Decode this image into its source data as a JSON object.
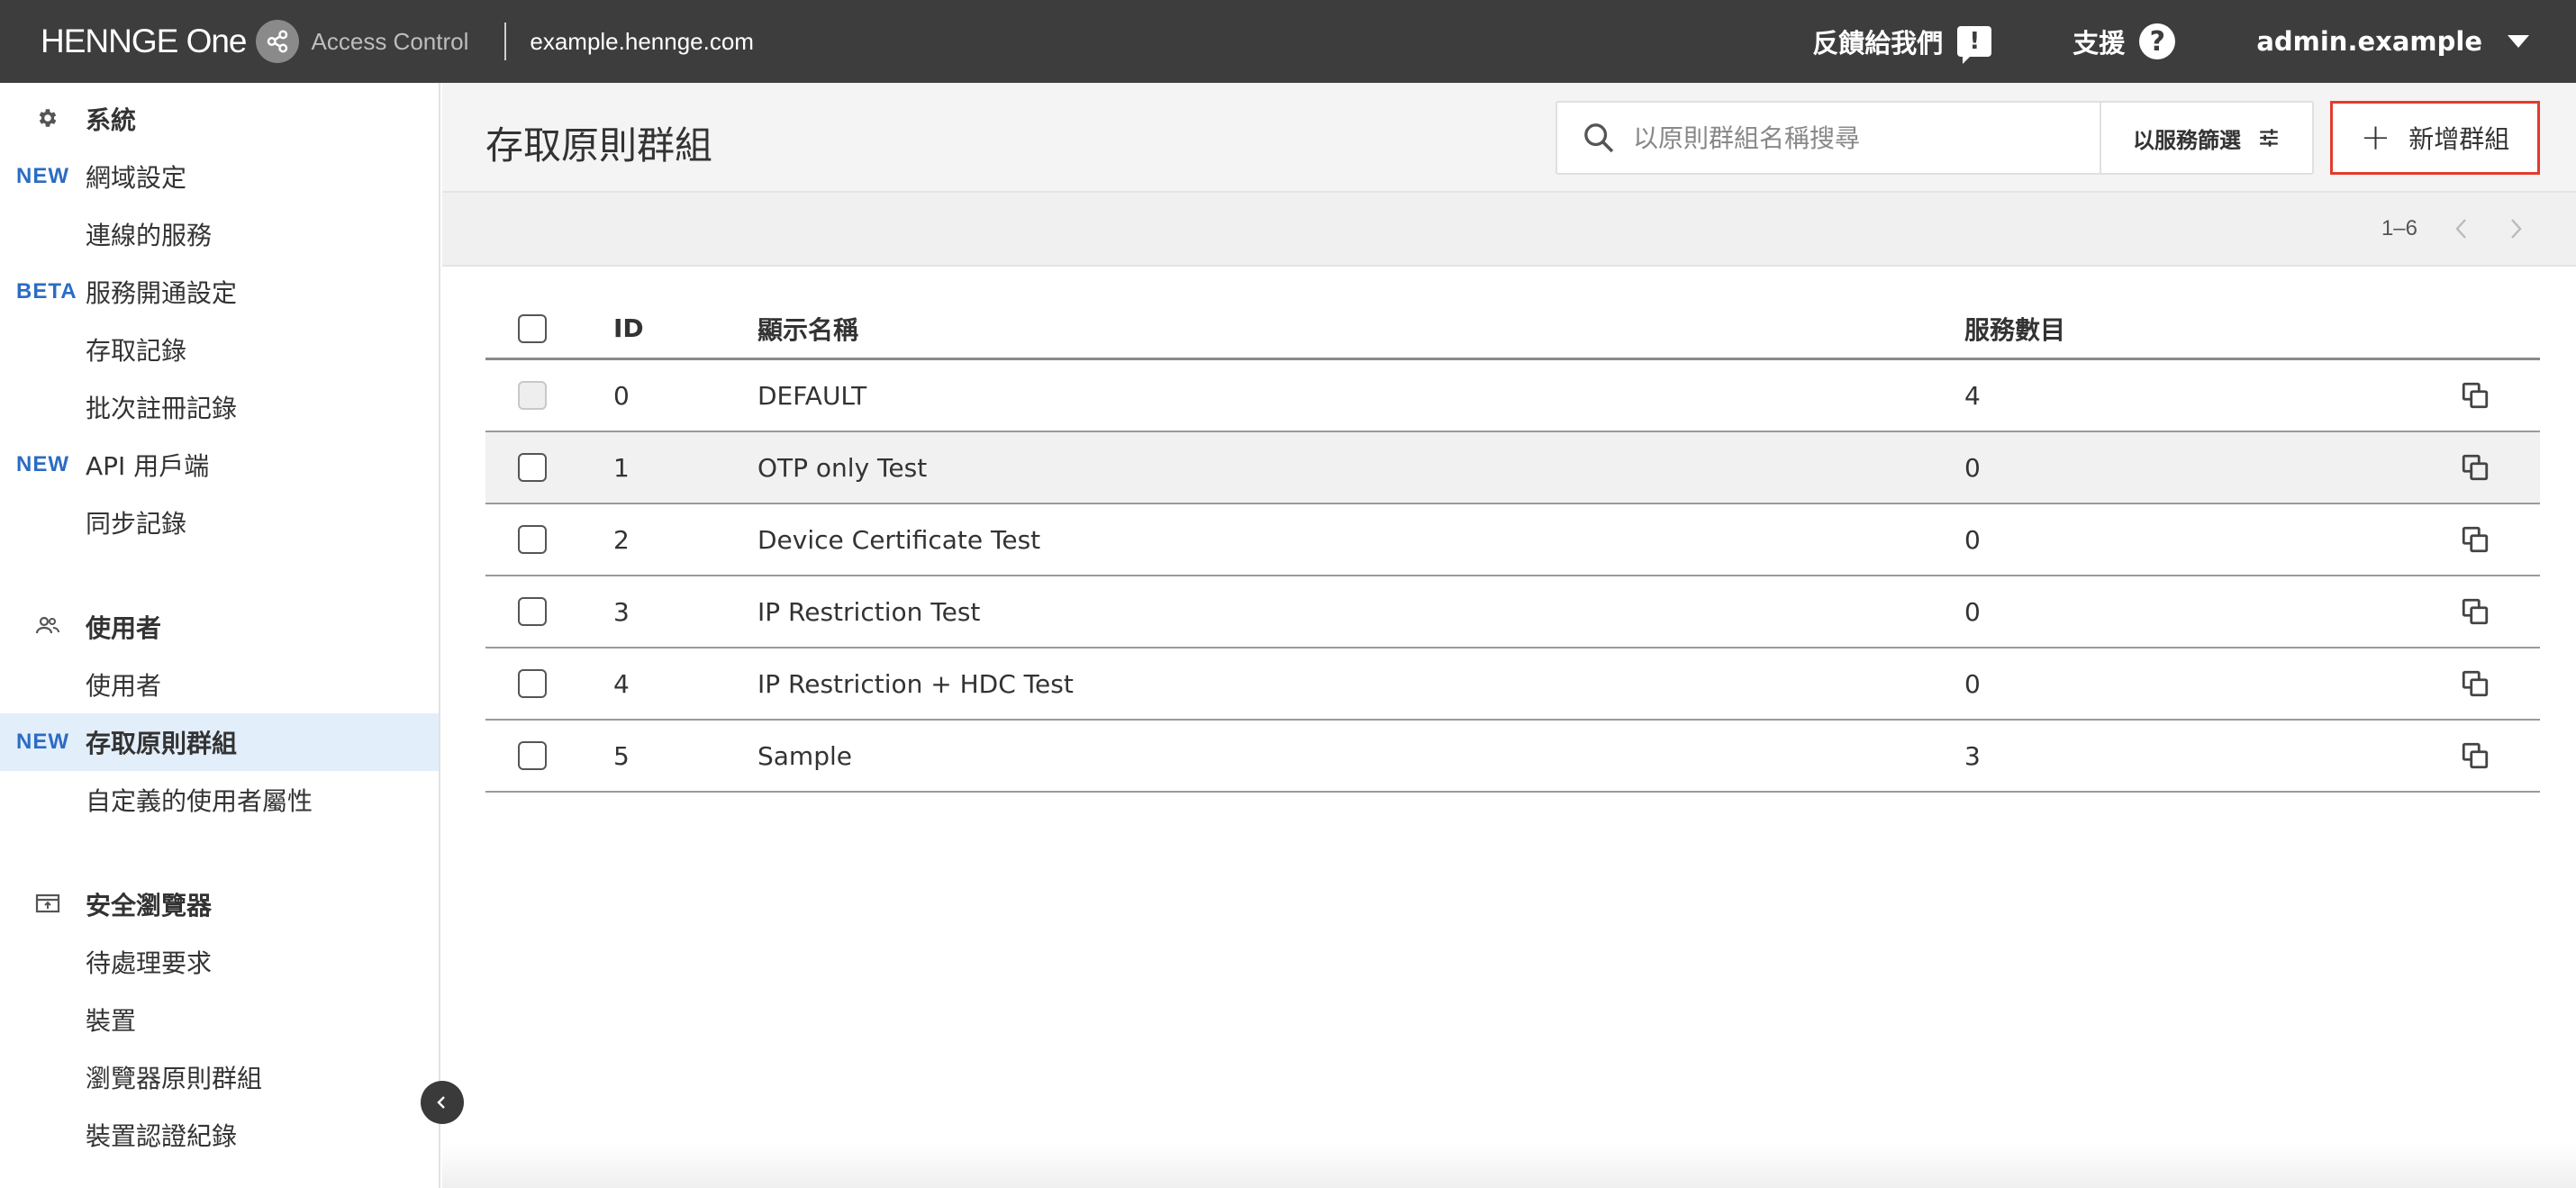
{
  "topbar": {
    "brand": "HENNGE One",
    "product": "Access Control",
    "tenant": "example.hennge.com",
    "feedback_label": "反饋給我們",
    "support_label": "支援",
    "account_label": "admin.example"
  },
  "sidebar": {
    "sections": [
      {
        "label": "系統",
        "icon": "gear-icon",
        "items": [
          {
            "badge": "NEW",
            "label": "網域設定"
          },
          {
            "badge": "",
            "label": "連線的服務"
          },
          {
            "badge": "BETA",
            "label": "服務開通設定"
          },
          {
            "badge": "",
            "label": "存取記錄"
          },
          {
            "badge": "",
            "label": "批次註冊記錄"
          },
          {
            "badge": "NEW",
            "label": "API 用戶端"
          },
          {
            "badge": "",
            "label": "同步記錄"
          }
        ]
      },
      {
        "label": "使用者",
        "icon": "users-icon",
        "items": [
          {
            "badge": "",
            "label": "使用者"
          },
          {
            "badge": "NEW",
            "label": "存取原則群組",
            "active": true
          },
          {
            "badge": "",
            "label": "自定義的使用者屬性"
          }
        ]
      },
      {
        "label": "安全瀏覽器",
        "icon": "browser-icon",
        "items": [
          {
            "badge": "",
            "label": "待處理要求"
          },
          {
            "badge": "",
            "label": "裝置"
          },
          {
            "badge": "",
            "label": "瀏覽器原則群組"
          },
          {
            "badge": "",
            "label": "裝置認證紀錄"
          }
        ]
      }
    ]
  },
  "main": {
    "title": "存取原則群組",
    "search_placeholder": "以原則群組名稱搜尋",
    "filter_label": "以服務篩選",
    "add_label": "新增群組",
    "pager_range": "1–6",
    "table": {
      "headers": {
        "id": "ID",
        "name": "顯示名稱",
        "count": "服務數目"
      },
      "rows": [
        {
          "id": "0",
          "name": "DEFAULT",
          "count": "4"
        },
        {
          "id": "1",
          "name": "OTP only Test",
          "count": "0"
        },
        {
          "id": "2",
          "name": "Device Certificate Test",
          "count": "0"
        },
        {
          "id": "3",
          "name": "IP Restriction Test",
          "count": "0"
        },
        {
          "id": "4",
          "name": "IP Restriction + HDC Test",
          "count": "0"
        },
        {
          "id": "5",
          "name": "Sample",
          "count": "3"
        }
      ]
    }
  },
  "colors": {
    "topbar": "#3d3d3d",
    "accent_badge": "#2b6cc4",
    "active_item_bg": "#e3eefb",
    "add_button_border": "#e23b2e"
  }
}
